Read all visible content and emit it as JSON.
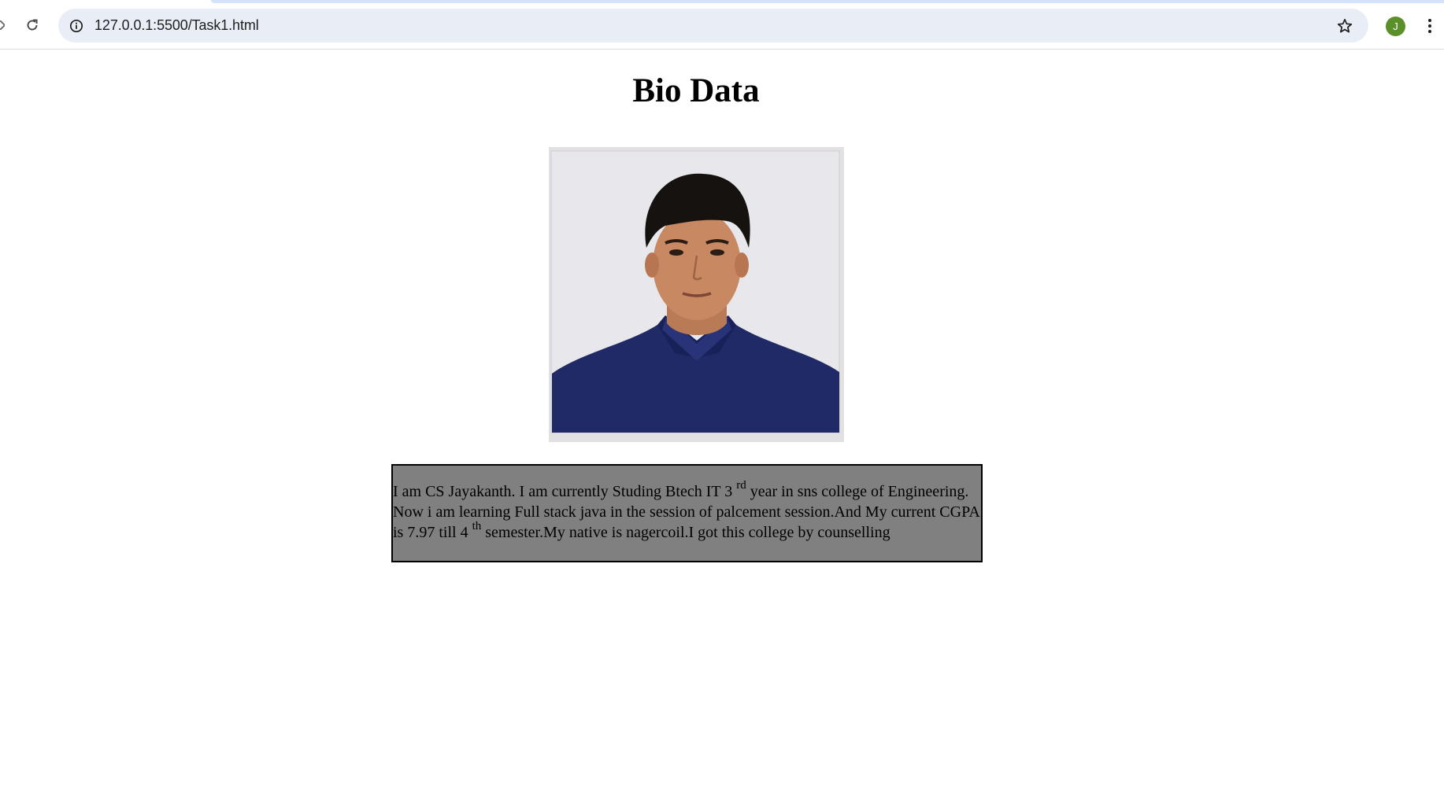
{
  "browser": {
    "url": "127.0.0.1:5500/Task1.html",
    "profile_initial": "J",
    "profile_color": "#5a8f29",
    "icons": {
      "reload": "reload-icon",
      "site_info": "info-icon",
      "bookmark": "star-icon",
      "menu": "kebab-menu-icon"
    }
  },
  "page": {
    "title": "Bio Data",
    "photo_alt": "Profile photo",
    "bio": {
      "part1": "I am CS Jayakanth. I am currently Studing Btech IT 3 ",
      "sup1": "rd",
      "part2": " year in sns college of Engineering. Now i am learning Full stack java in the session of palcement session.And My current CGPA is 7.97 till 4 ",
      "sup2": "th",
      "part3": " semester.My native is nagercoil.I got this college by counselling"
    },
    "bio_background": "#808080"
  }
}
